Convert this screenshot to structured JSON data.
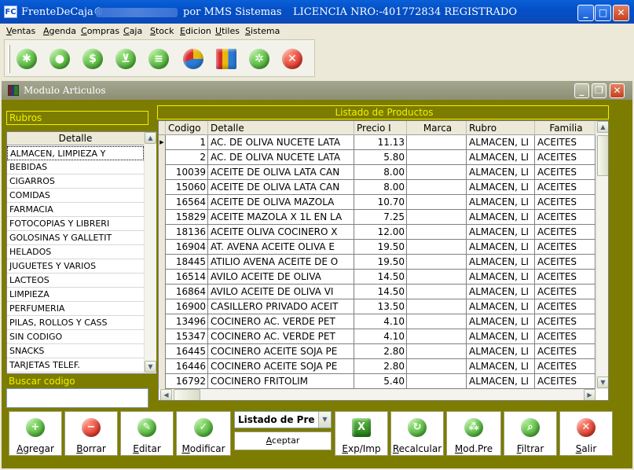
{
  "window": {
    "app_name": "FrenteDeCaja®",
    "by": "por MMS Sistemas",
    "license": "LICENCIA NRO:-401772834 REGISTRADO",
    "icon_text": "FC"
  },
  "menu": [
    "Ventas",
    "Agenda",
    "Compras",
    "Caja",
    "Stock",
    "Edicion",
    "Utiles",
    "Sistema"
  ],
  "toolbar": {
    "icons": [
      "asterisk-icon",
      "user-icon",
      "money-icon",
      "cart-icon",
      "notes-icon",
      "pie-chart-icon",
      "bar-chart-icon",
      "gear-icon",
      "close-icon"
    ]
  },
  "module": {
    "title": "Modulo Articulos"
  },
  "rubros": {
    "label": "Rubros",
    "header": "Detalle",
    "items": [
      "ALMACEN, LIMPIEZA Y",
      "BEBIDAS",
      "CIGARROS",
      "COMIDAS",
      "FARMACIA",
      "FOTOCOPIAS Y LIBRERI",
      "GOLOSINAS Y GALLETIT",
      "HELADOS",
      "JUGUETES Y VARIOS",
      "LACTEOS",
      "LIMPIEZA",
      "PERFUMERIA",
      "PILAS, ROLLOS Y CASS",
      "SIN CODIGO",
      "SNACKS",
      "TARJETAS TELEF."
    ]
  },
  "buscar": {
    "label": "Buscar codigo",
    "value": ""
  },
  "productos": {
    "label": "Listado de Productos",
    "columns": [
      "Codigo",
      "Detalle",
      "Precio I",
      "Marca",
      "Rubro",
      "Familia"
    ],
    "rows": [
      {
        "codigo": "1",
        "detalle": "AC. DE OLIVA NUCETE LATA",
        "precio": "11.13",
        "marca": "",
        "rubro": "ALMACEN, LI",
        "familia": "ACEITES"
      },
      {
        "codigo": "2",
        "detalle": "AC. DE OLIVA NUCETE LATA",
        "precio": "5.80",
        "marca": "",
        "rubro": "ALMACEN, LI",
        "familia": "ACEITES"
      },
      {
        "codigo": "10039",
        "detalle": "ACEITE DE OLIVA LATA CAN",
        "precio": "8.00",
        "marca": "",
        "rubro": "ALMACEN, LI",
        "familia": "ACEITES"
      },
      {
        "codigo": "15060",
        "detalle": "ACEITE DE OLIVA LATA CAN",
        "precio": "8.00",
        "marca": "",
        "rubro": "ALMACEN, LI",
        "familia": "ACEITES"
      },
      {
        "codigo": "16564",
        "detalle": "ACEITE DE OLIVA MAZOLA",
        "precio": "10.70",
        "marca": "",
        "rubro": "ALMACEN, LI",
        "familia": "ACEITES"
      },
      {
        "codigo": "15829",
        "detalle": "ACEITE MAZOLA X 1L EN LA",
        "precio": "7.25",
        "marca": "",
        "rubro": "ALMACEN, LI",
        "familia": "ACEITES"
      },
      {
        "codigo": "18136",
        "detalle": "ACEITE OLIVA COCINERO X",
        "precio": "12.00",
        "marca": "",
        "rubro": "ALMACEN, LI",
        "familia": "ACEITES"
      },
      {
        "codigo": "16904",
        "detalle": "AT. AVENA ACEITE OLIVA E",
        "precio": "19.50",
        "marca": "",
        "rubro": "ALMACEN, LI",
        "familia": "ACEITES"
      },
      {
        "codigo": "18445",
        "detalle": "ATILIO AVENA ACEITE DE O",
        "precio": "19.50",
        "marca": "",
        "rubro": "ALMACEN, LI",
        "familia": "ACEITES"
      },
      {
        "codigo": "16514",
        "detalle": "AVILO ACEITE DE OLIVA",
        "precio": "14.50",
        "marca": "",
        "rubro": "ALMACEN, LI",
        "familia": "ACEITES"
      },
      {
        "codigo": "16864",
        "detalle": "AVILO ACEITE DE OLIVA VI",
        "precio": "14.50",
        "marca": "",
        "rubro": "ALMACEN, LI",
        "familia": "ACEITES"
      },
      {
        "codigo": "16900",
        "detalle": "CASILLERO PRIVADO ACEIT",
        "precio": "13.50",
        "marca": "",
        "rubro": "ALMACEN, LI",
        "familia": "ACEITES"
      },
      {
        "codigo": "13496",
        "detalle": "COCINERO AC. VERDE PET",
        "precio": "4.10",
        "marca": "",
        "rubro": "ALMACEN, LI",
        "familia": "ACEITES"
      },
      {
        "codigo": "15347",
        "detalle": "COCINERO AC. VERDE PET",
        "precio": "4.10",
        "marca": "",
        "rubro": "ALMACEN, LI",
        "familia": "ACEITES"
      },
      {
        "codigo": "16445",
        "detalle": "COCINERO ACEITE SOJA PE",
        "precio": "2.80",
        "marca": "",
        "rubro": "ALMACEN, LI",
        "familia": "ACEITES"
      },
      {
        "codigo": "16446",
        "detalle": "COCINERO ACEITE SOJA PE",
        "precio": "2.80",
        "marca": "",
        "rubro": "ALMACEN, LI",
        "familia": "ACEITES"
      },
      {
        "codigo": "16792",
        "detalle": "COCINERO FRITOLIM",
        "precio": "5.40",
        "marca": "",
        "rubro": "ALMACEN, LI",
        "familia": "ACEITES"
      }
    ]
  },
  "listado_select": {
    "value": "Listado de Pre",
    "aceptar": "Aceptar"
  },
  "buttons": {
    "agregar": "Agregar",
    "borrar": "Borrar",
    "editar": "Editar",
    "modificar": "Modificar",
    "exp_imp": "Exp/Imp",
    "recalcular": "Recalcular",
    "mod_pre": "Mod.Pre",
    "filtrar": "Filtrar",
    "salir": "Salir"
  },
  "colors": {
    "titlebar": "#0350c7",
    "panel": "#7c7c00",
    "label_yellow": "#f0f000"
  }
}
